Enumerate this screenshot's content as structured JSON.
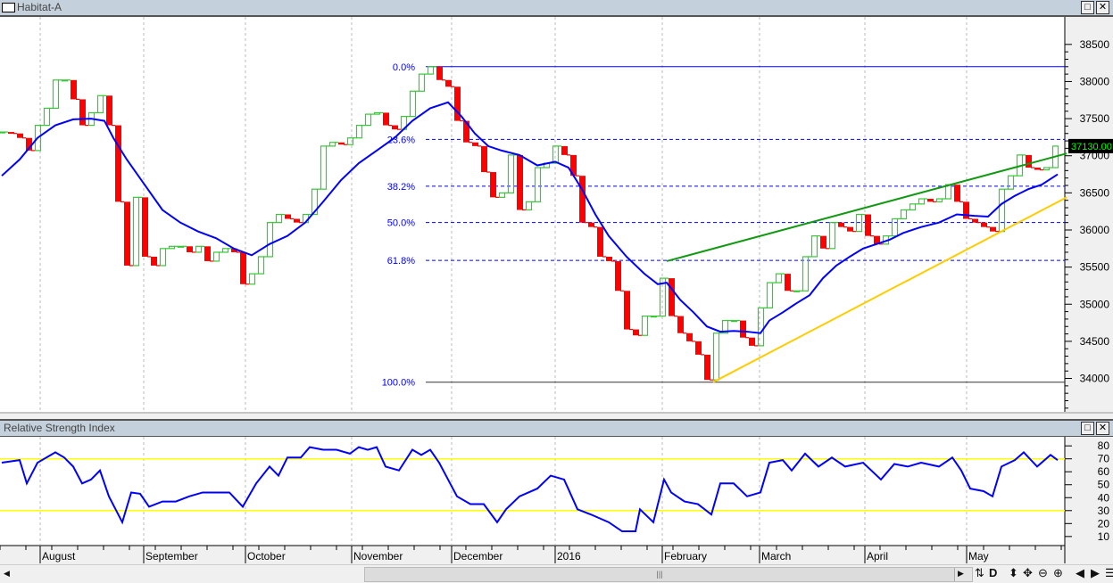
{
  "window": {
    "title": "Habitat-A",
    "maximize_icon": "maximize-icon",
    "close_icon": "close-icon"
  },
  "rsi_panel": {
    "title": "Relative Strength Index"
  },
  "colors": {
    "up": "#33cc33",
    "down": "#ff0000",
    "ma": "#0000ff",
    "fib": "#0000ff",
    "trend_green": "#119911",
    "trend_yellow": "#ffcc00",
    "rsi": "#0000ff",
    "rsi_bands": "#ffff00"
  },
  "price_axis": {
    "ticks": [
      38500,
      38000,
      37500,
      37000,
      36500,
      36000,
      35500,
      35000,
      34500,
      34000
    ],
    "range": [
      33550,
      38870
    ],
    "last_price_label": "37130.00",
    "last_price": 37130
  },
  "months": [
    {
      "label": "August",
      "idx": 4.3
    },
    {
      "label": "September",
      "idx": 15.9
    },
    {
      "label": "October",
      "idx": 27.3
    },
    {
      "label": "November",
      "idx": 39.2
    },
    {
      "label": "December",
      "idx": 50.4
    },
    {
      "label": "2016",
      "idx": 62.0
    },
    {
      "label": "February",
      "idx": 74.0
    },
    {
      "label": "March",
      "idx": 84.9
    },
    {
      "label": "April",
      "idx": 96.7
    },
    {
      "label": "May",
      "idx": 108.1
    }
  ],
  "fib_levels": [
    {
      "label": "0.0%",
      "price": 38200,
      "solid": true
    },
    {
      "label": "23.6%",
      "price": 37220,
      "solid": false
    },
    {
      "label": "38.2%",
      "price": 36590,
      "solid": false
    },
    {
      "label": "50.0%",
      "price": 36100,
      "solid": false
    },
    {
      "label": "61.8%",
      "price": 35590,
      "solid": false
    },
    {
      "label": "100.0%",
      "price": 33950,
      "solid": true
    }
  ],
  "fib_start_idx": 47.5,
  "trendlines": [
    {
      "name": "resistance",
      "color": "#119911",
      "from": [
        74.5,
        35580
      ],
      "to": [
        119.3,
        37030
      ]
    },
    {
      "name": "support",
      "color": "#ffcc00",
      "from": [
        79.7,
        33950
      ],
      "to": [
        119.3,
        36440
      ]
    }
  ],
  "closes": [
    37320,
    37300,
    37240,
    37070,
    37410,
    37640,
    38020,
    38020,
    37760,
    37410,
    37580,
    37810,
    37410,
    36380,
    35520,
    36440,
    35640,
    35520,
    35750,
    35780,
    35780,
    35700,
    35780,
    35580,
    35700,
    35750,
    35700,
    35270,
    35410,
    35640,
    36100,
    36210,
    36150,
    36100,
    36210,
    36550,
    37130,
    37180,
    37150,
    37240,
    37410,
    37560,
    37580,
    37410,
    37355,
    37530,
    37870,
    38100,
    38200,
    38020,
    37930,
    37470,
    37180,
    37130,
    36780,
    36440,
    36500,
    37010,
    36270,
    36380,
    36840,
    36900,
    37130,
    37010,
    36730,
    36100,
    36040,
    35640,
    35580,
    35180,
    34660,
    34580,
    34840,
    34840,
    35350,
    34840,
    34610,
    34500,
    34320,
    33980,
    34610,
    34780,
    34780,
    34550,
    34440,
    34950,
    35290,
    35410,
    35180,
    35180,
    35640,
    35920,
    35750,
    36100,
    36040,
    35980,
    36210,
    35920,
    35810,
    35920,
    36150,
    36270,
    36350,
    36420,
    36380,
    36420,
    36610,
    36380,
    36150,
    36100,
    36040,
    35980,
    36550,
    36730,
    37010,
    36840,
    36810,
    36840,
    37130
  ],
  "moving_average": [
    [
      0,
      36730
    ],
    [
      2,
      36950
    ],
    [
      4,
      37240
    ],
    [
      6,
      37410
    ],
    [
      8,
      37490
    ],
    [
      10,
      37500
    ],
    [
      11.5,
      37470
    ],
    [
      12.5,
      37240
    ],
    [
      14,
      36950
    ],
    [
      16,
      36610
    ],
    [
      18,
      36270
    ],
    [
      20,
      36100
    ],
    [
      22,
      35980
    ],
    [
      24,
      35890
    ],
    [
      26,
      35750
    ],
    [
      28,
      35660
    ],
    [
      30,
      35810
    ],
    [
      32,
      35920
    ],
    [
      34,
      36100
    ],
    [
      36,
      36380
    ],
    [
      38,
      36670
    ],
    [
      40,
      36900
    ],
    [
      42,
      37070
    ],
    [
      44,
      37240
    ],
    [
      46,
      37470
    ],
    [
      48,
      37640
    ],
    [
      50,
      37720
    ],
    [
      51.5,
      37530
    ],
    [
      53,
      37300
    ],
    [
      54.5,
      37130
    ],
    [
      56,
      37070
    ],
    [
      58,
      37010
    ],
    [
      60,
      36870
    ],
    [
      62,
      36920
    ],
    [
      63.5,
      36840
    ],
    [
      65,
      36550
    ],
    [
      66.5,
      36210
    ],
    [
      68,
      35920
    ],
    [
      70,
      35640
    ],
    [
      72,
      35410
    ],
    [
      73.5,
      35270
    ],
    [
      74.5,
      35290
    ],
    [
      76,
      35060
    ],
    [
      77.5,
      34890
    ],
    [
      79,
      34700
    ],
    [
      80.5,
      34630
    ],
    [
      82,
      34640
    ],
    [
      83.5,
      34630
    ],
    [
      85,
      34610
    ],
    [
      86,
      34780
    ],
    [
      87.5,
      34890
    ],
    [
      89,
      35010
    ],
    [
      90.5,
      35120
    ],
    [
      92,
      35350
    ],
    [
      93.5,
      35520
    ],
    [
      95,
      35640
    ],
    [
      96.5,
      35750
    ],
    [
      98,
      35810
    ],
    [
      99.5,
      35870
    ],
    [
      101,
      35960
    ],
    [
      103,
      36040
    ],
    [
      105,
      36100
    ],
    [
      107,
      36210
    ],
    [
      109,
      36190
    ],
    [
      110.5,
      36180
    ],
    [
      112,
      36350
    ],
    [
      113.5,
      36460
    ],
    [
      115,
      36550
    ],
    [
      116.5,
      36610
    ],
    [
      118.3,
      36750
    ]
  ],
  "rsi": {
    "ticks": [
      80,
      70,
      60,
      50,
      40,
      30,
      20,
      10
    ],
    "range": [
      3,
      87
    ],
    "bands": [
      70,
      30
    ],
    "values": [
      [
        0,
        67
      ],
      [
        2,
        69
      ],
      [
        2.8,
        51
      ],
      [
        4,
        67
      ],
      [
        5,
        71
      ],
      [
        6,
        75
      ],
      [
        7,
        71
      ],
      [
        8,
        64
      ],
      [
        9,
        51
      ],
      [
        10,
        54
      ],
      [
        11,
        61
      ],
      [
        12,
        41
      ],
      [
        13.5,
        21
      ],
      [
        14.5,
        44
      ],
      [
        15.5,
        43
      ],
      [
        16.5,
        33
      ],
      [
        18,
        37
      ],
      [
        19.5,
        37
      ],
      [
        21,
        41
      ],
      [
        22.5,
        44
      ],
      [
        24,
        44
      ],
      [
        25.5,
        44
      ],
      [
        27,
        33
      ],
      [
        28.5,
        51
      ],
      [
        30,
        64
      ],
      [
        31,
        57
      ],
      [
        32,
        71
      ],
      [
        33.5,
        71
      ],
      [
        34.5,
        79
      ],
      [
        36,
        77
      ],
      [
        37.5,
        77
      ],
      [
        39,
        74
      ],
      [
        40,
        79
      ],
      [
        41,
        77
      ],
      [
        42,
        79
      ],
      [
        43,
        64
      ],
      [
        44.5,
        61
      ],
      [
        46,
        77
      ],
      [
        47,
        73
      ],
      [
        48,
        77
      ],
      [
        49,
        67
      ],
      [
        50,
        54
      ],
      [
        51,
        41
      ],
      [
        52.5,
        35
      ],
      [
        54,
        35
      ],
      [
        55.5,
        21
      ],
      [
        56.5,
        31
      ],
      [
        58,
        41
      ],
      [
        60,
        47
      ],
      [
        61.5,
        57
      ],
      [
        63,
        54
      ],
      [
        64.5,
        31
      ],
      [
        66,
        27
      ],
      [
        68,
        21
      ],
      [
        69.5,
        14
      ],
      [
        71,
        14
      ],
      [
        71.5,
        31
      ],
      [
        73,
        21
      ],
      [
        74.2,
        54
      ],
      [
        75,
        44
      ],
      [
        76.5,
        37
      ],
      [
        78,
        35
      ],
      [
        79.5,
        27
      ],
      [
        80.5,
        51
      ],
      [
        82,
        51
      ],
      [
        83.5,
        41
      ],
      [
        85,
        44
      ],
      [
        86,
        67
      ],
      [
        87.5,
        69
      ],
      [
        88.5,
        61
      ],
      [
        90,
        74
      ],
      [
        91.5,
        64
      ],
      [
        93,
        71
      ],
      [
        94.5,
        64
      ],
      [
        96.5,
        67
      ],
      [
        98.5,
        54
      ],
      [
        100,
        66
      ],
      [
        101.5,
        64
      ],
      [
        103,
        67
      ],
      [
        105,
        64
      ],
      [
        106.5,
        71
      ],
      [
        107.5,
        61
      ],
      [
        108.5,
        47
      ],
      [
        110,
        45
      ],
      [
        111,
        41
      ],
      [
        112,
        64
      ],
      [
        113.5,
        69
      ],
      [
        114.5,
        75
      ],
      [
        116,
        64
      ],
      [
        117.5,
        73
      ],
      [
        118.3,
        69
      ]
    ]
  },
  "toolbar": {
    "icons": [
      "refresh-icon",
      "daily-icon",
      "vertical-zoom-icon",
      "pan-icon",
      "zoom-out-icon",
      "zoom-in-icon",
      "scroll-left-icon",
      "scroll-right-icon",
      "menu-icon"
    ],
    "daily_label": "D"
  }
}
